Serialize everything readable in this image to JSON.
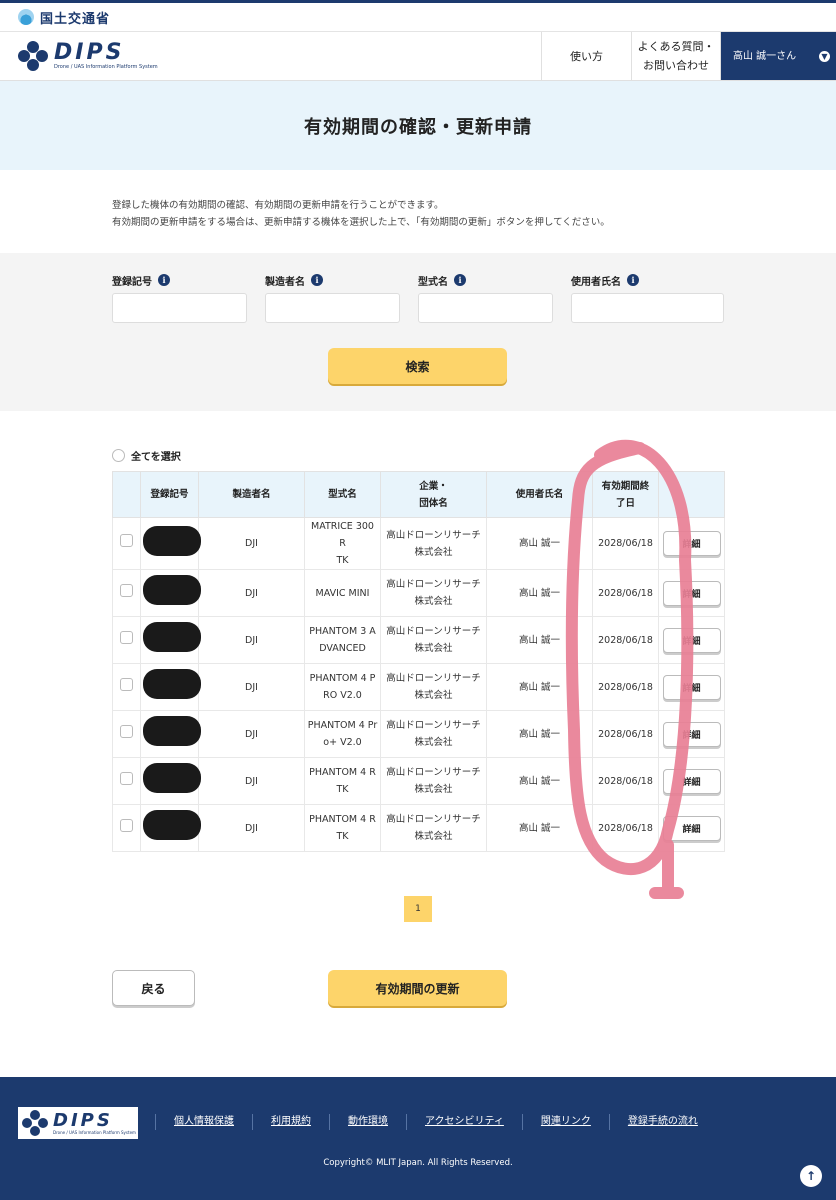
{
  "topbar": {
    "ministry": "国土交通省"
  },
  "header": {
    "brand": "DIPS",
    "brand_sub": "Drone / UAS Information Platform System",
    "nav_usage": "使い方",
    "nav_faq_line1": "よくある質問・",
    "nav_faq_line2": "お問い合わせ",
    "user": "高山 誠一さん"
  },
  "page": {
    "title": "有効期間の確認・更新申請",
    "desc1": "登録した機体の有効期間の確認、有効期間の更新申請を行うことができます。",
    "desc2": "有効期間の更新申請をする場合は、更新申請する機体を選択した上で、「有効期間の更新」ボタンを押してください。"
  },
  "search": {
    "reg_label": "登録記号",
    "maker_label": "製造者名",
    "model_label": "型式名",
    "user_label": "使用者氏名",
    "info_glyph": "i",
    "button": "検索"
  },
  "table": {
    "select_all": "全てを選択",
    "headers": {
      "reg": "登録記号",
      "maker": "製造者名",
      "model": "型式名",
      "company_line1": "企業・",
      "company_line2": "団体名",
      "user": "使用者氏名",
      "expiry_line1": "有効期間終",
      "expiry_line2": "了日"
    },
    "rows": [
      {
        "maker": "DJI",
        "model_line1": "MATRICE 300 R",
        "model_line2": "TK",
        "company_line1": "高山ドローンリサーチ",
        "company_line2": "株式会社",
        "user": "高山 誠一",
        "expiry": "2028/06/18",
        "detail": "詳細"
      },
      {
        "maker": "DJI",
        "model_line1": "MAVIC MINI",
        "model_line2": "",
        "company_line1": "高山ドローンリサーチ",
        "company_line2": "株式会社",
        "user": "高山 誠一",
        "expiry": "2028/06/18",
        "detail": "詳細"
      },
      {
        "maker": "DJI",
        "model_line1": "PHANTOM 3 A",
        "model_line2": "DVANCED",
        "company_line1": "高山ドローンリサーチ",
        "company_line2": "株式会社",
        "user": "高山 誠一",
        "expiry": "2028/06/18",
        "detail": "詳細"
      },
      {
        "maker": "DJI",
        "model_line1": "PHANTOM 4 P",
        "model_line2": "RO V2.0",
        "company_line1": "高山ドローンリサーチ",
        "company_line2": "株式会社",
        "user": "高山 誠一",
        "expiry": "2028/06/18",
        "detail": "詳細"
      },
      {
        "maker": "DJI",
        "model_line1": "PHANTOM 4 Pr",
        "model_line2": "o+ V2.0",
        "company_line1": "高山ドローンリサーチ",
        "company_line2": "株式会社",
        "user": "高山 誠一",
        "expiry": "2028/06/18",
        "detail": "詳細"
      },
      {
        "maker": "DJI",
        "model_line1": "PHANTOM 4 R",
        "model_line2": "TK",
        "company_line1": "高山ドローンリサーチ",
        "company_line2": "株式会社",
        "user": "高山 誠一",
        "expiry": "2028/06/18",
        "detail": "詳細"
      },
      {
        "maker": "DJI",
        "model_line1": "PHANTOM 4 R",
        "model_line2": "TK",
        "company_line1": "高山ドローンリサーチ",
        "company_line2": "株式会社",
        "user": "高山 誠一",
        "expiry": "2028/06/18",
        "detail": "詳細"
      }
    ]
  },
  "pagination": {
    "current": "1"
  },
  "actions": {
    "back": "戻る",
    "renew": "有効期間の更新"
  },
  "footer": {
    "brand": "DIPS",
    "brand_sub": "Drone / UAS Information Platform System",
    "links": [
      "個人情報保護",
      "利用規約",
      "動作環境",
      "アクセシビリティ",
      "関連リンク",
      "登録手続の流れ"
    ],
    "copyright": "Copyright© MLIT Japan. All Rights Reserved.",
    "to_top_glyph": "↑"
  },
  "colors": {
    "navy": "#1c3a6e",
    "hero_bg": "#e8f4fb",
    "button_yellow": "#fdd46a",
    "annotation_pink": "#e87f95"
  }
}
